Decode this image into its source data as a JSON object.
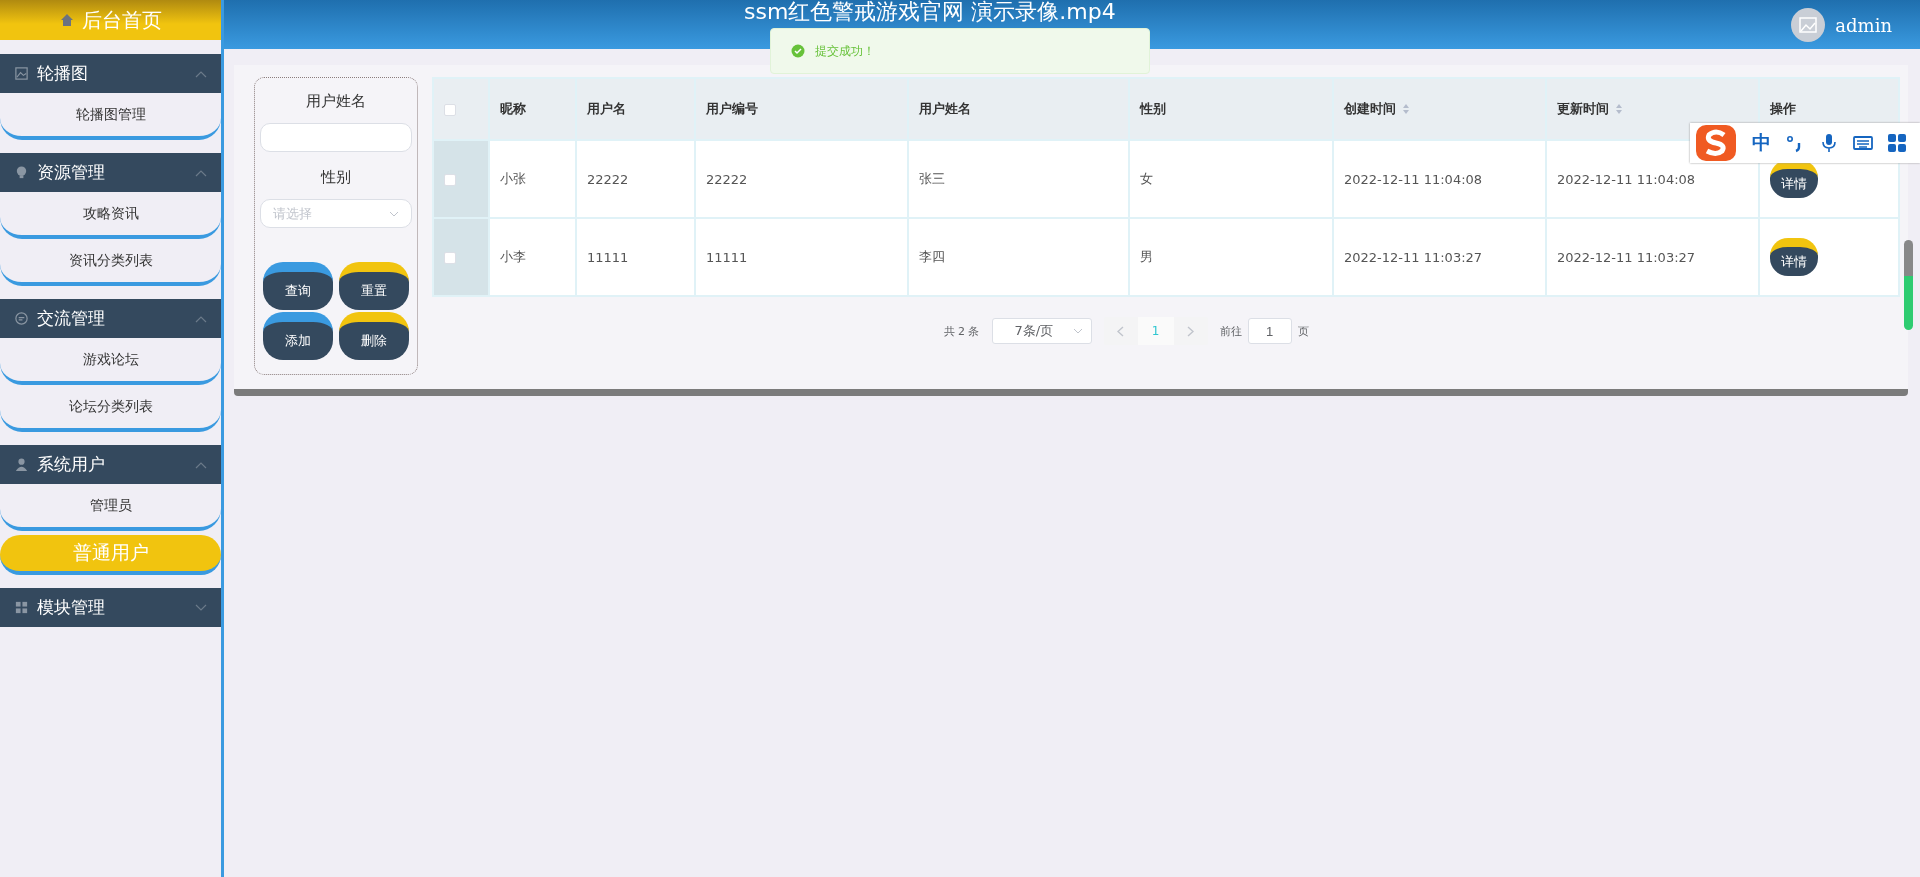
{
  "header": {
    "title": "ssm红色警戒游戏官网 演示录像.mp4",
    "user": "admin"
  },
  "toast": {
    "message": "提交成功！"
  },
  "sidebar": {
    "home": "后台首页",
    "groups": [
      {
        "title": "轮播图",
        "expanded": true,
        "items": [
          {
            "label": "轮播图管理",
            "selected": false
          }
        ]
      },
      {
        "title": "资源管理",
        "expanded": true,
        "items": [
          {
            "label": "攻略资讯",
            "selected": false
          },
          {
            "label": "资讯分类列表",
            "selected": false
          }
        ]
      },
      {
        "title": "交流管理",
        "expanded": true,
        "items": [
          {
            "label": "游戏论坛",
            "selected": false
          },
          {
            "label": "论坛分类列表",
            "selected": false
          }
        ]
      },
      {
        "title": "系统用户",
        "expanded": true,
        "items": [
          {
            "label": "管理员",
            "selected": false
          },
          {
            "label": "普通用户",
            "selected": true
          }
        ]
      },
      {
        "title": "模块管理",
        "expanded": false
      }
    ]
  },
  "filter": {
    "fields": [
      {
        "kind": "input",
        "label": "用户姓名"
      },
      {
        "kind": "select",
        "label": "性别",
        "placeholder": "请选择"
      }
    ],
    "buttons": [
      {
        "label": "查询",
        "color": "#3a9ae0"
      },
      {
        "label": "重置",
        "color": "#f1c40f"
      },
      {
        "label": "添加",
        "color": "#3a9ae0"
      },
      {
        "label": "删除",
        "color": "#f1c40f"
      }
    ]
  },
  "table": {
    "all_checked": false,
    "columns": [
      {
        "label": "昵称",
        "sortable": false
      },
      {
        "label": "用户名",
        "sortable": false
      },
      {
        "label": "用户编号",
        "sortable": false
      },
      {
        "label": "用户姓名",
        "sortable": false
      },
      {
        "label": "性别",
        "sortable": false
      },
      {
        "label": "创建时间",
        "sortable": true
      },
      {
        "label": "更新时间",
        "sortable": true
      },
      {
        "label": "操作",
        "sortable": false
      }
    ],
    "rows": [
      {
        "checked": false,
        "cells": [
          "小张",
          "22222",
          "22222",
          "张三",
          "女",
          "2022-12-11 11:04:08",
          "2022-12-11 11:04:08"
        ],
        "action": "详情"
      },
      {
        "checked": false,
        "cells": [
          "小李",
          "11111",
          "11111",
          "李四",
          "男",
          "2022-12-11 11:03:27",
          "2022-12-11 11:03:27"
        ],
        "action": "详情"
      }
    ]
  },
  "pagination": {
    "total": "共 2 条",
    "page_size": "7条/页",
    "pages": [
      {
        "label": "1",
        "selected": true
      }
    ],
    "goto_label": "前往",
    "goto_value": "1",
    "goto_suffix": "页"
  },
  "ime_toolbar": {
    "mode": "中"
  }
}
